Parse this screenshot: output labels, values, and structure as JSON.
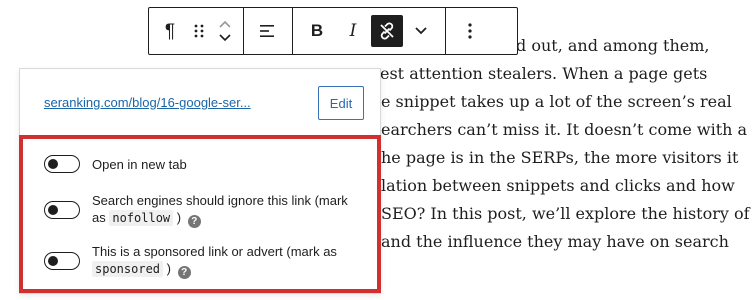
{
  "article": {
    "lines": [
      "d out, and among them,",
      "est attention stealers. When a page gets",
      "e snippet takes up a lot of the screen’s real",
      "earchers can’t miss it. It doesn’t come with a",
      "he page is in the SERPs, the more visitors it",
      "lation between snippets and clicks and how",
      " SEO? In this post, we’ll explore the history of",
      "and the influence they may have on search"
    ]
  },
  "toolbar": {
    "paragraph_icon": "pilcrow-icon",
    "drag_icon": "drag-handle-icon",
    "move_up_icon": "chevron-up-icon",
    "move_down_icon": "chevron-down-icon",
    "align_icon": "align-left-icon",
    "bold_label": "B",
    "italic_label": "I",
    "link_icon": "unlink-icon",
    "more_formats_icon": "chevron-down-icon",
    "options_icon": "more-vertical-icon"
  },
  "popover": {
    "link_url": "seranking.com/blog/16-google-ser...",
    "edit_label": "Edit",
    "settings": [
      {
        "label": "Open in new tab",
        "checked": false
      },
      {
        "label_before": "Search engines should ignore this link (mark as",
        "code": "nofollow",
        "label_after": ")",
        "checked": false
      },
      {
        "label_before": "This is a sponsored link or advert (mark as",
        "code": "sponsored",
        "label_after": ")",
        "checked": false
      }
    ]
  },
  "colors": {
    "highlight": "#d03030",
    "link": "#1a66a8",
    "edit_button": "#3872b8"
  }
}
